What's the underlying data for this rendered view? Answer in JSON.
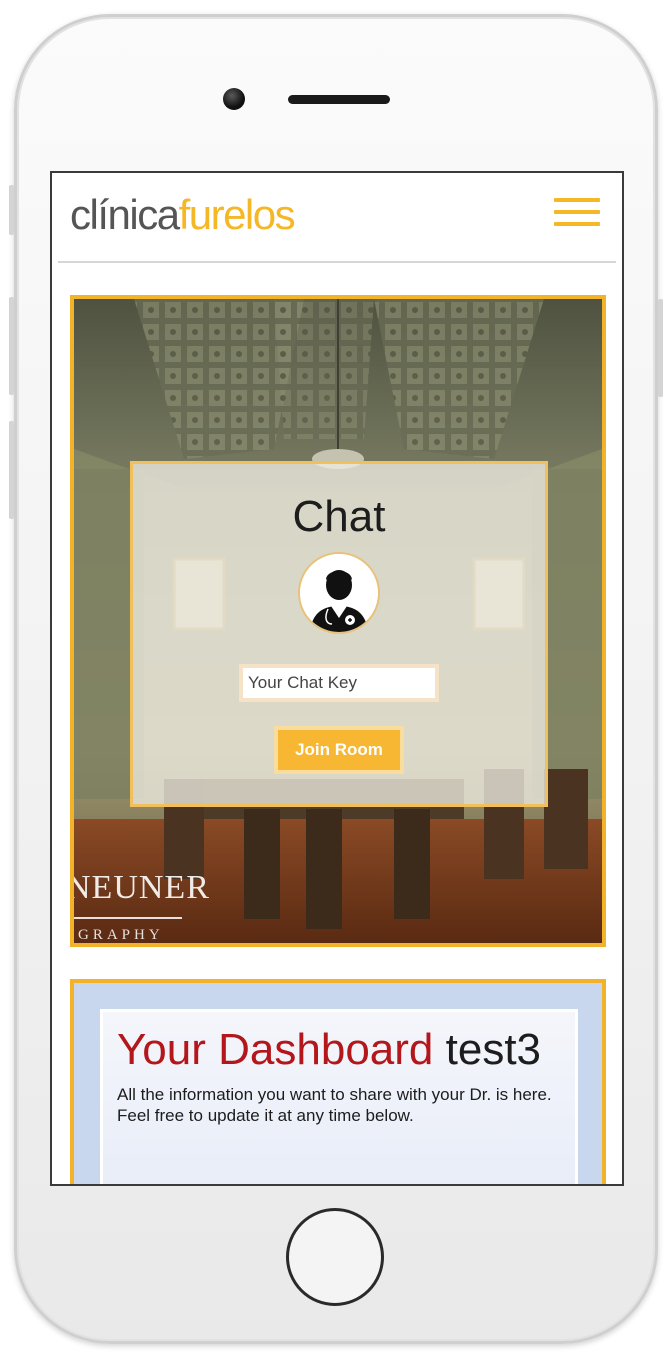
{
  "brand": {
    "logo_part1": "clínica",
    "logo_part2": "furelos",
    "accent_color": "#f6b726"
  },
  "nav": {
    "menu_icon": "hamburger-menu-icon"
  },
  "chat": {
    "title": "Chat",
    "avatar_icon": "doctor-avatar-icon",
    "input_placeholder": "Your Chat Key",
    "join_button": "Join Room"
  },
  "hero_watermark": {
    "name": "NEUNER",
    "sub": "GRAPHY"
  },
  "dashboard": {
    "title_highlight": "Your Dashboard",
    "username": "test3",
    "line1": "All the information you want to share with your Dr. is here.",
    "line2": "Feel free to update it at any time below."
  }
}
